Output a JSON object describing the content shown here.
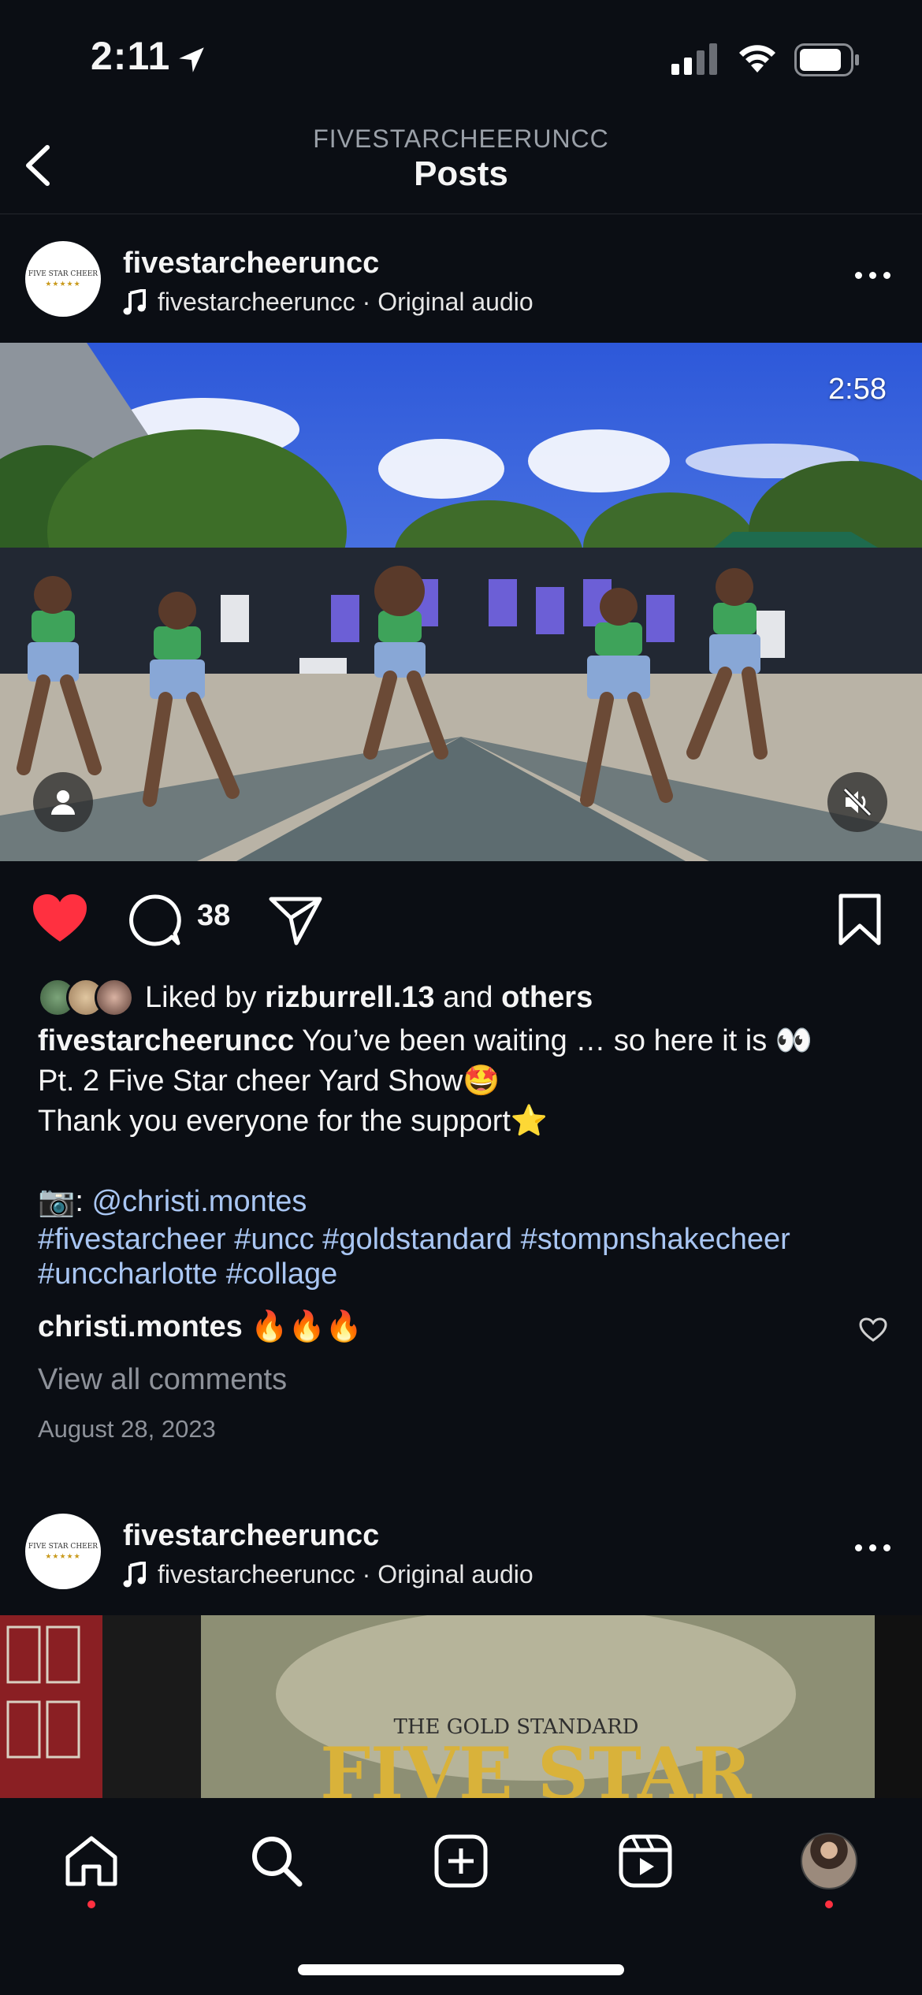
{
  "status": {
    "time": "2:11"
  },
  "header": {
    "subtitle": "FIVESTARCHEERUNCC",
    "title": "Posts"
  },
  "post1": {
    "username": "fivestarcheeruncc",
    "audio_user": "fivestarcheeruncc",
    "audio_label": "Original audio",
    "video_duration": "2:58",
    "comment_count": "38",
    "liked_by_prefix": "Liked by",
    "liked_by_user": "rizburrell.13",
    "liked_by_and": "and",
    "liked_by_others": "others",
    "caption_user": "fivestarcheeruncc",
    "caption_line1": "You’ve been waiting … so here it is 👀",
    "caption_line2": "Pt. 2 Five Star cheer Yard Show🤩",
    "caption_line3": "Thank you everyone for the support⭐️",
    "camera_prefix": "📷:",
    "camera_mention": "@christi.montes",
    "tags_line1": "#fivestarcheer #uncc #goldstandard #stompnshakecheer",
    "tags_line2": "#unccharlotte #collage",
    "comment_user": "christi.montes",
    "comment_text": "🔥🔥🔥",
    "view_all": "View all comments",
    "date": "August 28, 2023"
  },
  "post2": {
    "username": "fivestarcheeruncc",
    "audio_user": "fivestarcheeruncc",
    "audio_label": "Original audio"
  },
  "logo": {
    "line1": "FIVE STAR CHEER",
    "line2": "★★★★★"
  },
  "preview2": {
    "text1": "THE GOLD STANDARD",
    "text2": "FIVE STAR"
  },
  "tabs": [
    "home-icon",
    "search-icon",
    "create-icon",
    "reels-icon",
    "profile-avatar"
  ],
  "colors": {
    "bg": "#0b0e14",
    "like_red": "#ff3040",
    "hashtag": "#a9c6f3",
    "muted": "#8e929a"
  }
}
